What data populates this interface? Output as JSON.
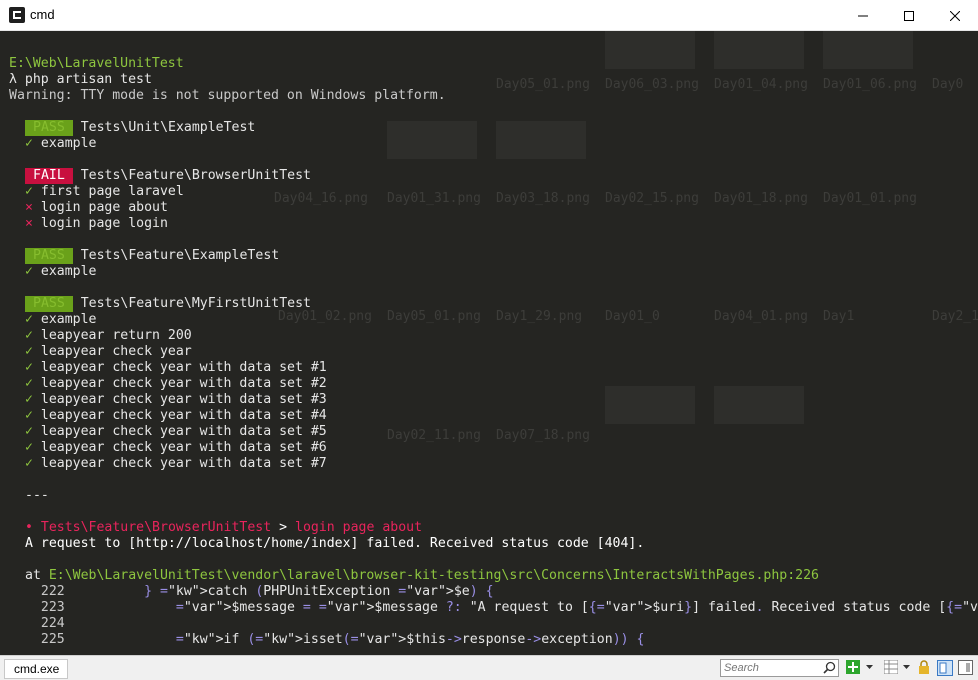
{
  "window": {
    "title": "cmd",
    "controls": {
      "minimize": "minimize-icon",
      "maximize": "maximize-icon",
      "close": "close-icon"
    }
  },
  "background_files": [
    "Day05_01.png",
    "Day06_03.png",
    "Day01_04.png",
    "Day01_06.png",
    "Day0",
    "Day04_16.png",
    "Day01_31.png",
    "Day03_18.png",
    "Day02_15.png",
    "Day01_18.png",
    "Day01_01.png",
    "Day01_02.png",
    "Day05_01.png",
    "Day1_29.png",
    "Day01_0",
    "Day04_01.png",
    "Day1",
    "Day2_1",
    "Day02_11.png",
    "Day07_18.png"
  ],
  "console": {
    "prompt_path": "E:\\Web\\LaravelUnitTest",
    "prompt_symbol": "λ",
    "command": "php artisan test",
    "warning": "Warning: TTY mode is not supported on Windows platform.",
    "groups": [
      {
        "status": "PASS",
        "suite": "Tests\\Unit\\ExampleTest",
        "tests": [
          {
            "mark": "✓",
            "name": "example"
          }
        ]
      },
      {
        "status": "FAIL",
        "suite": "Tests\\Feature\\BrowserUnitTest",
        "tests": [
          {
            "mark": "✓",
            "name": "first page laravel"
          },
          {
            "mark": "⨯",
            "name": "login page about"
          },
          {
            "mark": "⨯",
            "name": "login page login"
          }
        ]
      },
      {
        "status": "PASS",
        "suite": "Tests\\Feature\\ExampleTest",
        "tests": [
          {
            "mark": "✓",
            "name": "example"
          }
        ]
      },
      {
        "status": "PASS",
        "suite": "Tests\\Feature\\MyFirstUnitTest",
        "tests": [
          {
            "mark": "✓",
            "name": "example"
          },
          {
            "mark": "✓",
            "name": "leapyear return 200"
          },
          {
            "mark": "✓",
            "name": "leapyear check year"
          },
          {
            "mark": "✓",
            "name": "leapyear check year with data set #1"
          },
          {
            "mark": "✓",
            "name": "leapyear check year with data set #2"
          },
          {
            "mark": "✓",
            "name": "leapyear check year with data set #3"
          },
          {
            "mark": "✓",
            "name": "leapyear check year with data set #4"
          },
          {
            "mark": "✓",
            "name": "leapyear check year with data set #5"
          },
          {
            "mark": "✓",
            "name": "leapyear check year with data set #6"
          },
          {
            "mark": "✓",
            "name": "leapyear check year with data set #7"
          }
        ]
      }
    ],
    "separator": "---",
    "failure": {
      "bullet": "•",
      "test": "Tests\\Feature\\BrowserUnitTest",
      "arrow": ">",
      "case": "login page about",
      "message": "A request to [http://localhost/home/index] failed. Received status code [404].",
      "at_label": "at",
      "location": "E:\\Web\\LaravelUnitTest\\vendor\\laravel\\browser-kit-testing\\src\\Concerns\\InteractsWithPages.php:226",
      "code_lines": [
        {
          "num": "222",
          "code": "        } catch (PHPUnitException $e) {"
        },
        {
          "num": "223",
          "code": "            $message = $message ?: \"A request to [{$uri}] failed. Received status code [{$status}].\";"
        },
        {
          "num": "224",
          "code": ""
        },
        {
          "num": "225",
          "code": "            if (isset($this->response->exception)) {"
        }
      ]
    }
  },
  "statusbar": {
    "tab_label": "cmd.exe",
    "search_placeholder": "Search",
    "icons": [
      "search-icon",
      "add-console-icon",
      "dropdown-icon",
      "grid-icon",
      "dropdown-icon",
      "lock-icon",
      "split-view-icon",
      "layout-icon"
    ],
    "accent": "#2da52d"
  }
}
